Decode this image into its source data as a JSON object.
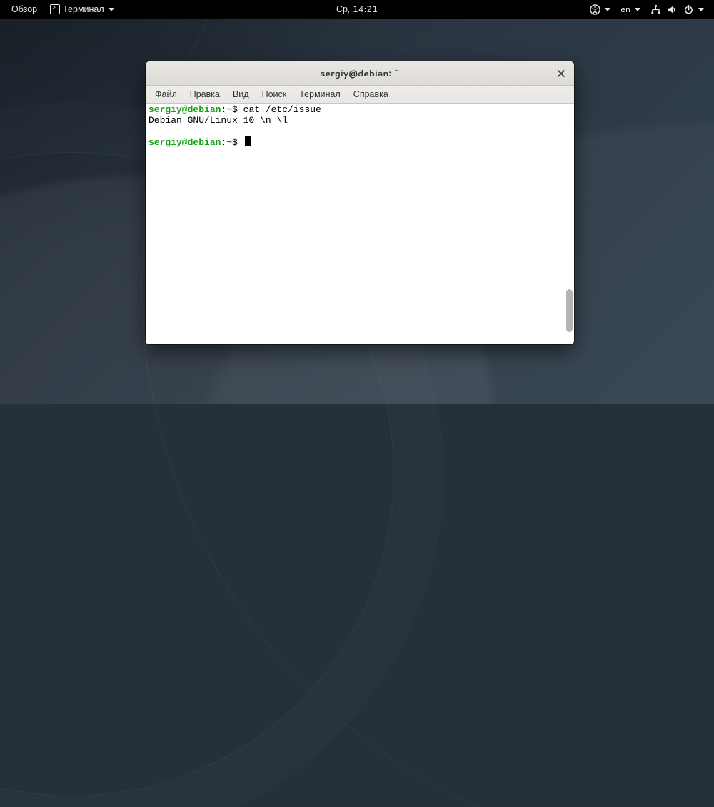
{
  "panel": {
    "activities": "Обзор",
    "app_name": "Терминал",
    "clock": "Ср, 14:21",
    "lang": "en"
  },
  "window": {
    "title": "sergiy@debian: ~",
    "menus": {
      "file": "Файл",
      "edit": "Правка",
      "view": "Вид",
      "search": "Поиск",
      "terminal": "Терминал",
      "help": "Справка"
    }
  },
  "terminal": {
    "prompt_user": "sergiy@debian",
    "prompt_sep": ":",
    "prompt_path": "~",
    "prompt_sigil": "$ ",
    "line1_cmd": "cat /etc/issue",
    "line2_output": "Debian GNU/Linux 10 \\n \\l"
  }
}
